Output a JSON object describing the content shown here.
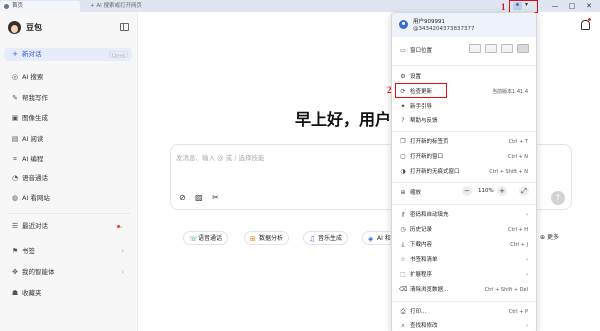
{
  "titlebar": {
    "tab_home": "首页",
    "tab_new": "+ AI 搜索或打开网页",
    "win_minimize": "—",
    "win_maximize": "□",
    "win_close": "✕",
    "profile_caret": "▾",
    "annotation_1": "1",
    "annotation_2": "2"
  },
  "sidebar": {
    "app_name": "豆包",
    "items": [
      {
        "label": "新对话",
        "icon": "plus-icon",
        "glyph": "+",
        "shortcut": "Ctrl+K",
        "active": true
      },
      {
        "label": "AI 搜索",
        "icon": "search-icon",
        "glyph": "◎"
      },
      {
        "label": "帮我写作",
        "icon": "pen-icon",
        "glyph": "✎"
      },
      {
        "label": "图像生成",
        "icon": "image-icon",
        "glyph": "▣"
      },
      {
        "label": "AI 阅读",
        "icon": "book-icon",
        "glyph": "▤"
      },
      {
        "label": "AI 编程",
        "icon": "code-icon",
        "glyph": "⌗"
      },
      {
        "label": "语音通话",
        "icon": "phone-icon",
        "glyph": "◔"
      },
      {
        "label": "AI 看网站",
        "icon": "globe-icon",
        "glyph": "◍"
      }
    ],
    "recent_label": "最近对话",
    "bookmarks_label": "书签",
    "agents_label": "我的智能体",
    "favorites_label": "收藏夹",
    "recent_glyph": "☰",
    "bookmarks_glyph": "⚑",
    "agents_glyph": "✥",
    "favorites_glyph": "☗",
    "chev": "›",
    "chev_down": "⌄"
  },
  "main": {
    "greeting": "早上好，用户",
    "chat_placeholder": "发消息、输入 @ 或 / 选择技能",
    "tools": {
      "attach": "⊘",
      "image": "▨",
      "scissors": "✂"
    },
    "send": "↑",
    "skills": [
      {
        "label": "语音通话",
        "glyph": "☏",
        "color": "#2a9d4b"
      },
      {
        "label": "数据分析",
        "glyph": "⊞",
        "color": "#e07b1a"
      },
      {
        "label": "音乐生成",
        "glyph": "♫",
        "color": "#a43fd8"
      },
      {
        "label": "AI 和",
        "glyph": "◈",
        "color": "#2d5bd7"
      }
    ],
    "more_label": "更多",
    "more_glyph": "⊕"
  },
  "menu": {
    "user": "用户909991",
    "user_id": "@3434204373837377",
    "window_position": "窗口位置",
    "settings": "设置",
    "check_update": "检查更新",
    "version": "当前版本1.41.4",
    "new_guide": "新手引导",
    "help": "帮助与反馈",
    "new_tab": "打开新的标签页",
    "new_tab_sc": "Ctrl + T",
    "new_window": "打开新的窗口",
    "new_window_sc": "Ctrl + N",
    "incognito": "打开新的无痕式窗口",
    "incognito_sc": "Ctrl + Shift + N",
    "zoom": "缩放",
    "zoom_minus": "−",
    "zoom_value": "110%",
    "zoom_plus": "+",
    "zoom_full": "⤢",
    "passwords": "密码和自动填充",
    "history": "历史记录",
    "history_sc": "Ctrl + H",
    "downloads": "下载内容",
    "downloads_sc": "Ctrl + J",
    "bookmarks": "书签和清单",
    "extensions": "扩展程序",
    "clear_data": "清除浏览数据...",
    "clear_data_sc": "Ctrl + Shift + Del",
    "print": "打印...",
    "print_sc": "Ctrl + P",
    "find": "查找和修改",
    "arrow": "›",
    "icons": {
      "window": "▭",
      "settings": "⚙",
      "update": "⟳",
      "guide": "✦",
      "help": "?",
      "tab": "❐",
      "newwin": "▢",
      "incognito": "◑",
      "zoom": "⊕",
      "key": "⚷",
      "history": "◷",
      "download": "⤓",
      "bookmark": "☆",
      "extension": "⬚",
      "clear": "⌫",
      "print": "⎙",
      "find": "⌕"
    }
  },
  "colors": {
    "accent": "#2d5bd7",
    "annotation": "#dd1111"
  }
}
